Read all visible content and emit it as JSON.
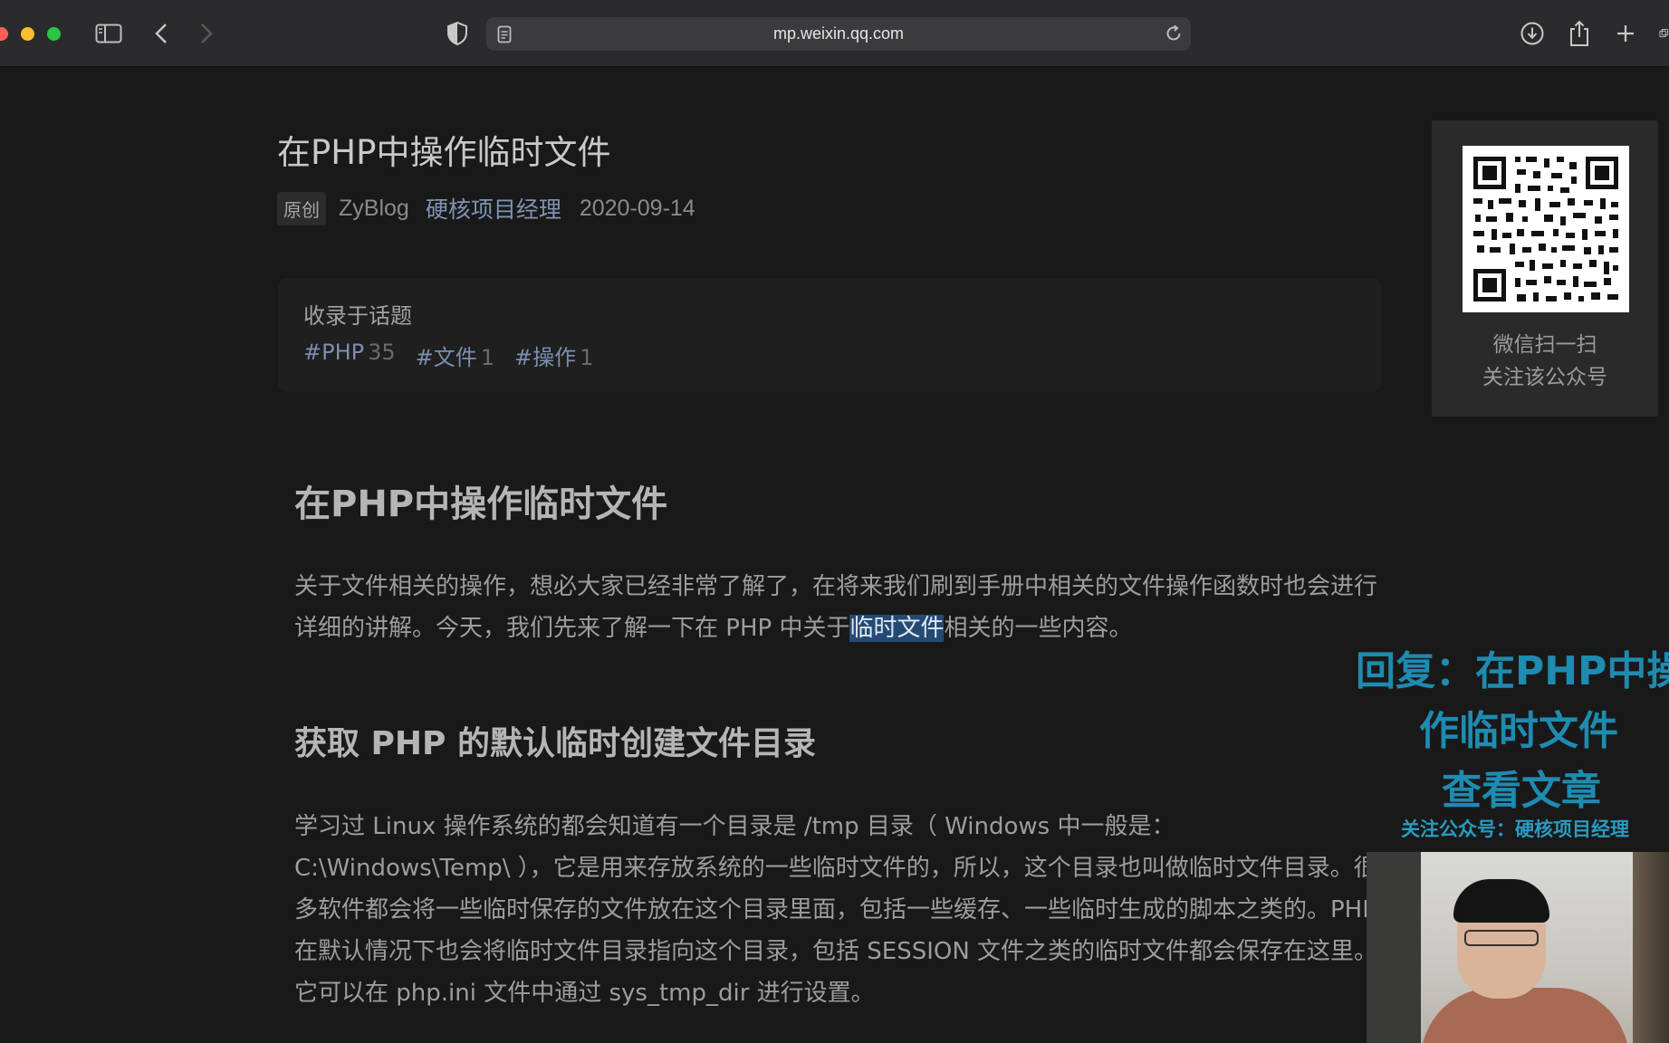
{
  "browser": {
    "url": "mp.weixin.qq.com"
  },
  "article": {
    "title": "在PHP中操作临时文件",
    "badge": "原创",
    "author": "ZyBlog",
    "account": "硬核项目经理",
    "date": "2020-09-14",
    "topic_label": "收录于话题",
    "tags": [
      {
        "name": "#PHP",
        "count": "35"
      },
      {
        "name": "#文件",
        "count": "1"
      },
      {
        "name": "#操作",
        "count": "1"
      }
    ],
    "heading1": "在PHP中操作临时文件",
    "para1_before": "关于文件相关的操作，想必大家已经非常了解了，在将来我们刷到手册中相关的文件操作函数时也会进行详细的讲解。今天，我们先来了解一下在 PHP 中关于",
    "para1_highlight": "临时文件",
    "para1_after": "相关的一些内容。",
    "heading2": "获取 PHP 的默认临时创建文件目录",
    "para2": "学习过 Linux 操作系统的都会知道有一个目录是 /tmp 目录（ Windows 中一般是： C:\\Windows\\Temp\\ ），它是用来存放系统的一些临时文件的，所以，这个目录也叫做临时文件目录。很多软件都会将一些临时保存的文件放在这个目录里面，包括一些缓存、一些临时生成的脚本之类的。PHP 在默认情况下也会将临时文件目录指向这个目录，包括 SESSION 文件之类的临时文件都会保存在这里。它可以在 php.ini 文件中通过 sys_tmp_dir 进行设置。"
  },
  "qr_panel": {
    "caption_line1": "微信扫一扫",
    "caption_line2": "关注该公众号"
  },
  "promo": {
    "line1": "回复：在PHP中操",
    "line2": "作临时文件",
    "line3": "查看文章",
    "line4": "关注公众号：硬核项目经理"
  },
  "colors": {
    "background": "#191919",
    "link": "#7e93b3",
    "promo": "#1e8bb0",
    "highlight": "#244a74"
  }
}
